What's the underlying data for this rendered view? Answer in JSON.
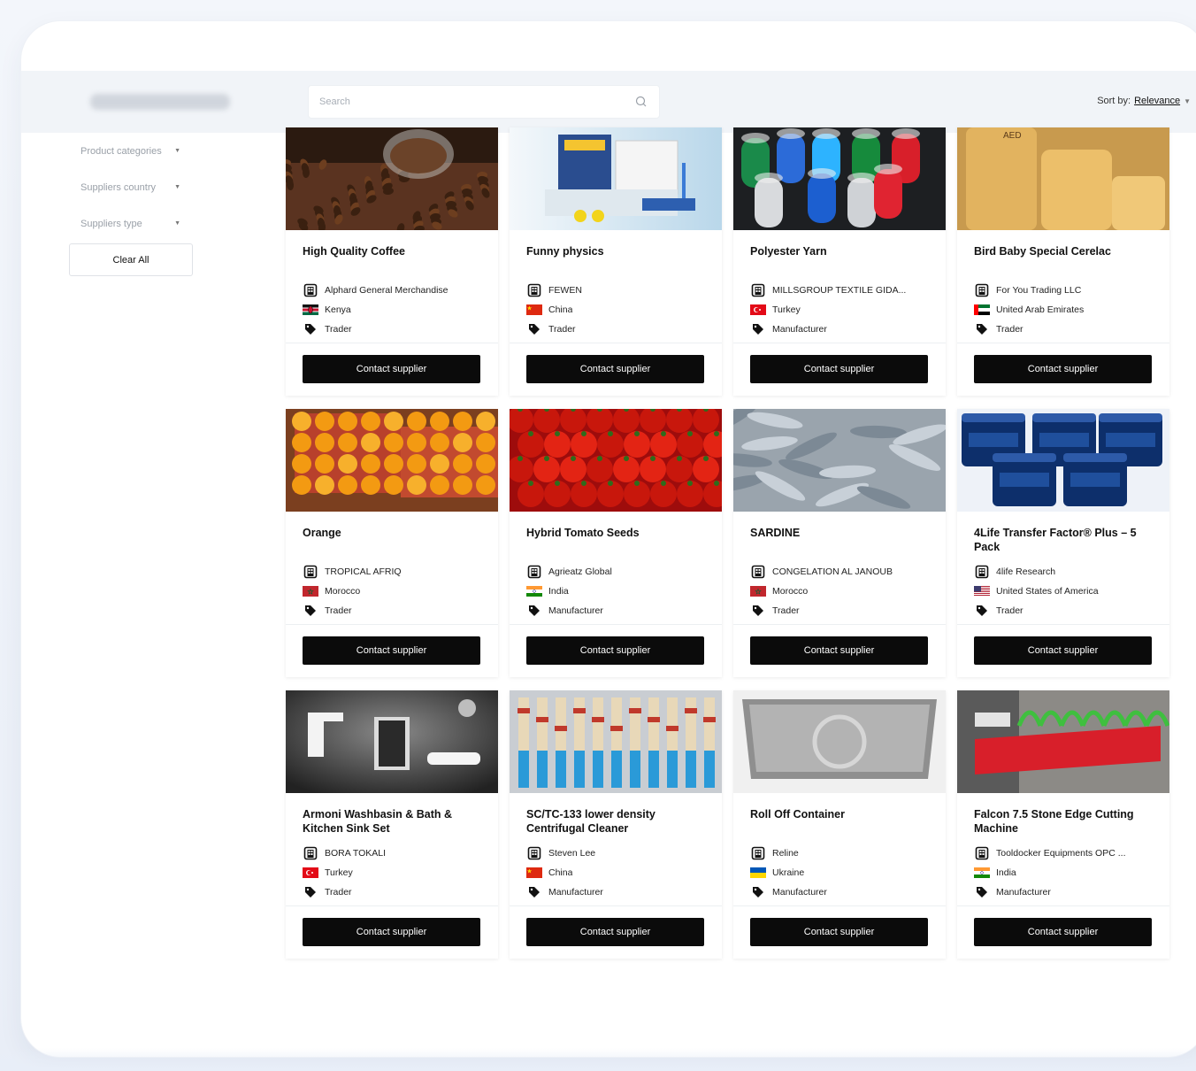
{
  "header": {
    "search_placeholder": "Search",
    "sort_label": "Sort by:",
    "sort_value": "Relevance"
  },
  "sidebar": {
    "filters": [
      {
        "label": "Product categories"
      },
      {
        "label": "Suppliers country"
      },
      {
        "label": "Suppliers type"
      }
    ],
    "clear_all": "Clear All"
  },
  "contact_label": "Contact supplier",
  "products": [
    {
      "title": "High Quality Coffee",
      "supplier": "Alphard General Merchandise",
      "country": "Kenya",
      "flag": "kenya",
      "type": "Trader",
      "image": "coffee-beans"
    },
    {
      "title": "Funny physics",
      "supplier": "FEWEN",
      "country": "China",
      "flag": "china",
      "type": "Trader",
      "image": "physics-kit"
    },
    {
      "title": "Polyester Yarn",
      "supplier": "MILLSGROUP TEXTILE GIDA...",
      "country": "Turkey",
      "flag": "turkey",
      "type": "Manufacturer",
      "image": "yarn-spools"
    },
    {
      "title": "Bird Baby Special Cerelac",
      "supplier": "For You Trading LLC",
      "country": "United Arab Emirates",
      "flag": "uae",
      "type": "Trader",
      "image": "cerelac-jars"
    },
    {
      "title": "Orange",
      "supplier": "TROPICAL AFRIQ",
      "country": "Morocco",
      "flag": "morocco",
      "type": "Trader",
      "image": "oranges"
    },
    {
      "title": "Hybrid Tomato Seeds",
      "supplier": "Agrieatz Global",
      "country": "India",
      "flag": "india",
      "type": "Manufacturer",
      "image": "tomatoes"
    },
    {
      "title": "SARDINE",
      "supplier": "CONGELATION AL JANOUB",
      "country": "Morocco",
      "flag": "morocco",
      "type": "Trader",
      "image": "sardines"
    },
    {
      "title": "4Life Transfer Factor® Plus – 5 Pack",
      "supplier": "4life Research",
      "country": "United States of America",
      "flag": "usa",
      "type": "Trader",
      "image": "supplement-jars"
    },
    {
      "title": "Armoni Washbasin & Bath & Kitchen Sink Set",
      "supplier": "BORA TOKALI",
      "country": "Turkey",
      "flag": "turkey",
      "type": "Trader",
      "image": "faucets"
    },
    {
      "title": "SC/TC-133 lower density Centrifugal Cleaner",
      "supplier": "Steven Lee",
      "country": "China",
      "flag": "china",
      "type": "Manufacturer",
      "image": "centrifugal-cleaner"
    },
    {
      "title": "Roll Off Container",
      "supplier": "Reline",
      "country": "Ukraine",
      "flag": "ukraine",
      "type": "Manufacturer",
      "image": "container"
    },
    {
      "title": "Falcon 7.5 Stone Edge Cutting Machine",
      "supplier": "Tooldocker Equipments OPC ...",
      "country": "India",
      "flag": "india",
      "type": "Manufacturer",
      "image": "cutting-machine"
    }
  ]
}
